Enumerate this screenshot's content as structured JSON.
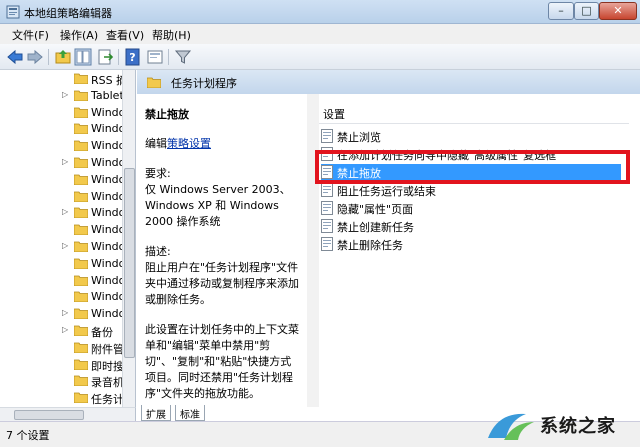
{
  "window": {
    "title": "本地组策略编辑器"
  },
  "menu": {
    "items": [
      "文件(F)",
      "操作(A)",
      "查看(V)",
      "帮助(H)"
    ]
  },
  "tree": {
    "items": [
      {
        "label": "RSS 摘",
        "expander": ""
      },
      {
        "label": "Tablet",
        "expander": "▷"
      },
      {
        "label": "Windo",
        "expander": ""
      },
      {
        "label": "Windo",
        "expander": ""
      },
      {
        "label": "Windo",
        "expander": ""
      },
      {
        "label": "Windo",
        "expander": "▷"
      },
      {
        "label": "Windo",
        "expander": ""
      },
      {
        "label": "Windo",
        "expander": ""
      },
      {
        "label": "Windo",
        "expander": "▷"
      },
      {
        "label": "Windo",
        "expander": ""
      },
      {
        "label": "Windo",
        "expander": "▷"
      },
      {
        "label": "Windo",
        "expander": ""
      },
      {
        "label": "Windo",
        "expander": ""
      },
      {
        "label": "Windo",
        "expander": ""
      },
      {
        "label": "Windo",
        "expander": "▷"
      },
      {
        "label": "备份",
        "expander": "▷"
      },
      {
        "label": "附件管",
        "expander": ""
      },
      {
        "label": "即时搜",
        "expander": ""
      },
      {
        "label": "录音机",
        "expander": ""
      },
      {
        "label": "任务计",
        "expander": ""
      }
    ]
  },
  "details": {
    "header": "任务计划程序",
    "desc_title": "禁止拖放",
    "edit_prefix": "编辑",
    "edit_link": "策略设置",
    "req_label": "要求:",
    "req_text": "仅 Windows Server 2003、Windows XP 和 Windows 2000 操作系统",
    "desc_label": "描述:",
    "desc_text": "阻止用户在\"任务计划程序\"文件夹中通过移动或复制程序来添加或删除任务。",
    "desc_text2": "此设置在计划任务中的上下文菜单和\"编辑\"菜单中禁用\"剪切\"、\"复制\"和\"粘贴\"快捷方式项目。同时还禁用\"任务计划程序\"文件夹的拖放功能。"
  },
  "list": {
    "column": "设置",
    "items": [
      {
        "label": "禁止浏览",
        "selected": false
      },
      {
        "label": "在添加计划任务向导中隐藏\"高级属性\"复选框",
        "selected": false
      },
      {
        "label": "禁止拖放",
        "selected": true
      },
      {
        "label": "阻止任务运行或结束",
        "selected": false
      },
      {
        "label": "隐藏\"属性\"页面",
        "selected": false
      },
      {
        "label": "禁止创建新任务",
        "selected": false
      },
      {
        "label": "禁止删除任务",
        "selected": false
      }
    ]
  },
  "tabs": [
    "扩展",
    "标准"
  ],
  "status": {
    "text": "7 个设置"
  },
  "watermark": {
    "text": "系统之家"
  },
  "colors": {
    "selection": "#3399ff",
    "highlight_box": "#e2141e",
    "link": "#0033aa"
  }
}
